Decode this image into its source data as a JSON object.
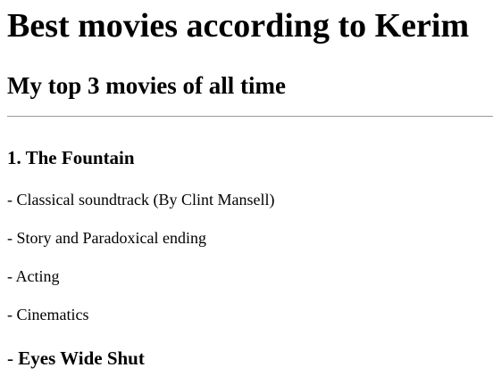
{
  "page": {
    "title": "Best movies according to Kerim",
    "subtitle": "My top 3 movies of all time"
  },
  "movies": [
    {
      "heading": "1. The Fountain",
      "points": [
        "- Classical soundtrack (By Clint Mansell)",
        "- Story and Paradoxical ending",
        "- Acting",
        "- Cinematics"
      ]
    }
  ],
  "next_entry": {
    "prefix": "- ",
    "title": "Eyes Wide Shut"
  }
}
